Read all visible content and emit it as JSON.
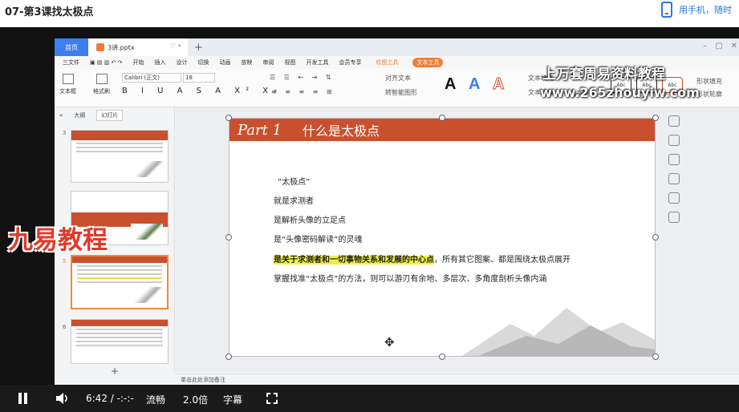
{
  "page": {
    "title": "07-第3课找太极点",
    "mobile_text": "用手机，随时"
  },
  "app": {
    "home_tab": "首页",
    "doc_tab": "3讲.pptx",
    "menu": {
      "file": "三文件",
      "items": [
        "开始",
        "插入",
        "设计",
        "切换",
        "动画",
        "放映",
        "审阅",
        "视图",
        "开发工具",
        "会员专享"
      ],
      "drawing_tools": "绘图工具",
      "text_tools": "文本工具"
    },
    "ribbon": {
      "textbox": "文本框",
      "format_painter": "格式刷",
      "font_name": "Calibri (正文)",
      "font_size": "18",
      "bold_row": "B I U A S A X² X₂",
      "align_text": "对齐文本",
      "convert_smartart": "转智能图形",
      "text_fill": "文本填充",
      "text_outline": "文本轮廓",
      "text_effect": "文本效果",
      "shape_fill": "形状填充",
      "shape_outline": "形状轮廓",
      "style_labels": [
        "Abc",
        "Abc",
        "Abc"
      ]
    },
    "sidebar": {
      "tab_outline": "大纲",
      "tab_slides": "幻灯片",
      "slide_numbers": [
        "3",
        "5",
        "6"
      ],
      "add_label": "+"
    },
    "slide": {
      "part": "Part 1",
      "heading": "什么是太极点",
      "lines": [
        "“太极点”",
        "就是求测者",
        "是解析头像的立足点",
        "是“头像密码解读”的灵魂"
      ],
      "highlight_line": "是关于求测者和一切事物关系和发展的中心点",
      "highlight_suffix": "，所有其它图案、都是围绕太极点展开",
      "last_line": "掌握找准“太极点”的方法，则可以游刃有余地、多层次、多角度剖析头像内涵"
    },
    "notes": "单击此处添加备注"
  },
  "watermarks": {
    "line1": "上万套周易资料教程",
    "line2": "www.265zhouyiw.com",
    "left_overlay": "九易教程"
  },
  "player": {
    "time": "6:42",
    "separator": "/",
    "duration": "-:-:-",
    "quality": "流畅",
    "speed": "2.0倍",
    "subtitle": "字幕"
  },
  "colors": {
    "accent": "#c9502e",
    "link": "#2a7ad8",
    "highlight": "#f1ef43",
    "tab_orange": "#f07f3b"
  }
}
